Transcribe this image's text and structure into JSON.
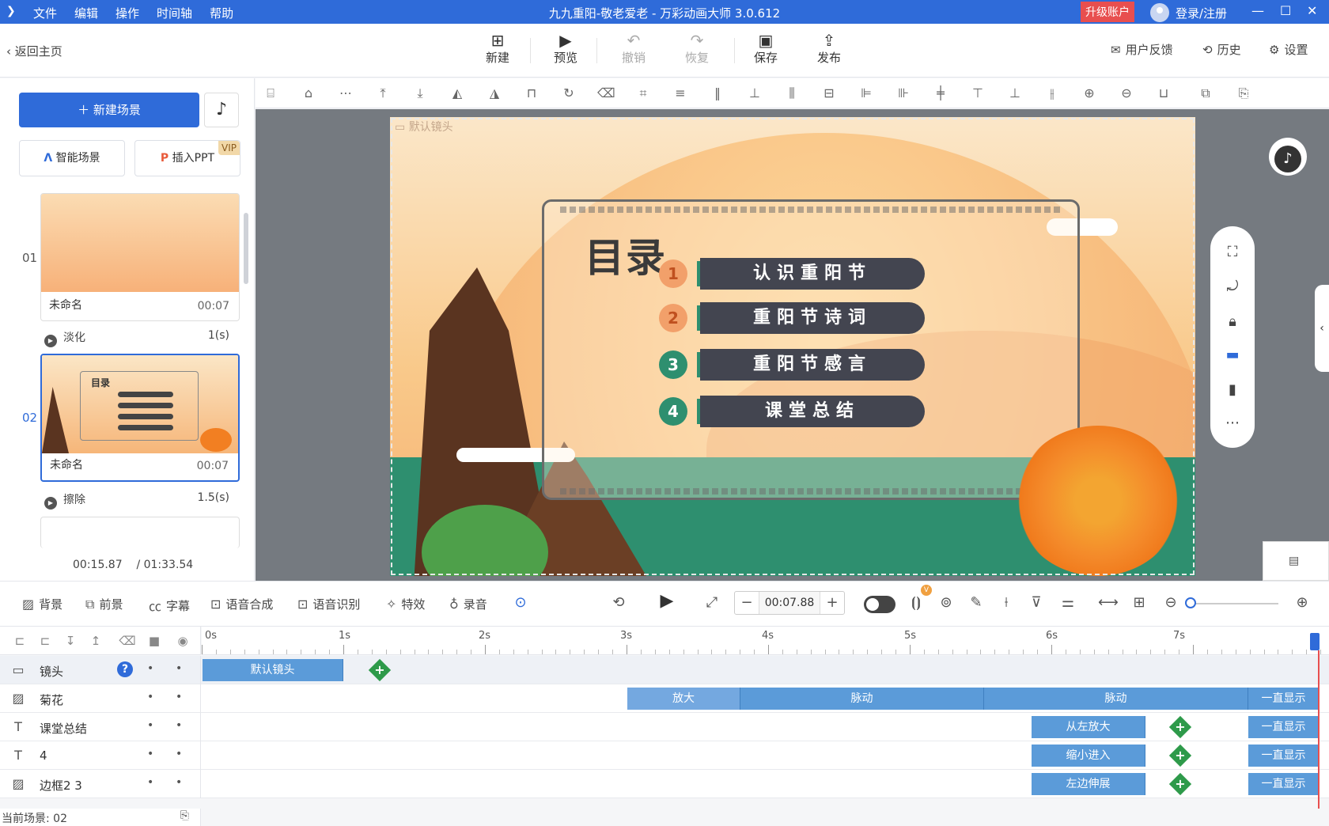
{
  "titlebar": {
    "logo": "❯",
    "menu": [
      "文件",
      "编辑",
      "操作",
      "时间轴",
      "帮助"
    ],
    "title": "九九重阳-敬老爱老 - 万彩动画大师 3.0.612",
    "upgrade": "升级账户",
    "login": "登录/注册",
    "controls": {
      "minimize": "—",
      "maximize": "☐",
      "close": "✕"
    }
  },
  "header": {
    "back": "返回主页",
    "tools": [
      {
        "label": "新建",
        "icon": "plus-square-icon"
      },
      {
        "label": "预览",
        "icon": "play-icon"
      },
      {
        "label": "撤销",
        "icon": "undo-icon"
      },
      {
        "label": "恢复",
        "icon": "redo-icon"
      },
      {
        "label": "保存",
        "icon": "save-icon"
      },
      {
        "label": "发布",
        "icon": "publish-icon"
      }
    ],
    "feedback": "用户反馈",
    "history": "历史",
    "settings": "设置"
  },
  "left": {
    "new_scene": "新建场景",
    "smart_scene": "智能场景",
    "insert_ppt": "插入PPT",
    "vip": "VIP",
    "scenes": [
      {
        "num": "01",
        "name": "未命名",
        "duration": "00:07",
        "transition": "淡化",
        "transition_time": "1(s)"
      },
      {
        "num": "02",
        "name": "未命名",
        "duration": "00:07",
        "transition": "擦除",
        "transition_time": "1.5(s)"
      }
    ],
    "current_time": "00:15.87",
    "total_time": "/ 01:33.54"
  },
  "slide": {
    "camera_label": "默认镜头",
    "toc_title": "目录",
    "items": [
      {
        "num": "1",
        "text": "认识重阳节"
      },
      {
        "num": "2",
        "text": "重阳节诗词"
      },
      {
        "num": "3",
        "text": "重阳节感言"
      },
      {
        "num": "4",
        "text": "课堂总结"
      }
    ],
    "thumb_title": "目录"
  },
  "timeline_toolbar": {
    "background": "背景",
    "foreground": "前景",
    "subtitle": "字幕",
    "tts": "语音合成",
    "asr": "语音识别",
    "effects": "特效",
    "record": "录音",
    "time_value": "00:07.88",
    "minus": "−",
    "plus": "+",
    "v_badge": "V"
  },
  "ruler": [
    "0s",
    "1s",
    "2s",
    "3s",
    "4s",
    "5s",
    "6s",
    "7s"
  ],
  "tracks": [
    {
      "name": "镜头",
      "icon": "camera-icon"
    },
    {
      "name": "菊花",
      "icon": "image-icon"
    },
    {
      "name": "课堂总结",
      "icon": "text-icon"
    },
    {
      "name": "4",
      "icon": "text-icon"
    },
    {
      "name": "边框2 3",
      "icon": "image-icon"
    }
  ],
  "clips": {
    "camera": "默认镜头",
    "flower": [
      "放大",
      "脉动",
      "脉动",
      "一直显示"
    ],
    "summary": [
      "从左放大",
      "一直显示"
    ],
    "four": [
      "缩小进入",
      "一直显示"
    ],
    "border": [
      "左边伸展",
      "一直显示"
    ]
  },
  "status": {
    "current_scene": "当前场景: 02"
  },
  "colors": {
    "accent": "#2f6bd9",
    "danger": "#e84f4f",
    "green": "#2e8f6f",
    "bar": "#434550"
  }
}
